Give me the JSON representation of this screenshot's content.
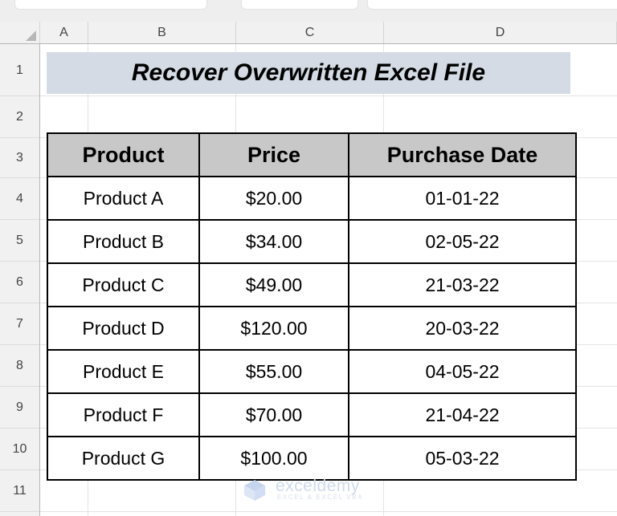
{
  "app": {
    "type": "spreadsheet",
    "ribbon_groups": [
      "ribbon-group-1",
      "ribbon-group-2",
      "ribbon-group-3"
    ]
  },
  "grid": {
    "select_all_icon": "select-all-triangle-icon",
    "column_headers": [
      "A",
      "B",
      "C",
      "D"
    ],
    "row_headers": [
      "1",
      "2",
      "3",
      "4",
      "5",
      "6",
      "7",
      "8",
      "9",
      "10",
      "11"
    ]
  },
  "title_banner": {
    "text": "Recover Overwritten Excel File",
    "background": "#d4dbe4",
    "cell_range": "B2:D2"
  },
  "table": {
    "header_background": "#c8c8c8",
    "border_color": "#000000",
    "columns": [
      "Product",
      "Price",
      "Purchase Date"
    ],
    "rows": [
      {
        "product": "Product A",
        "price": "$20.00",
        "date": "01-01-22"
      },
      {
        "product": "Product B",
        "price": "$34.00",
        "date": "02-05-22"
      },
      {
        "product": "Product C",
        "price": "$49.00",
        "date": "21-03-22"
      },
      {
        "product": "Product D",
        "price": "$120.00",
        "date": "20-03-22"
      },
      {
        "product": "Product E",
        "price": "$55.00",
        "date": "04-05-22"
      },
      {
        "product": "Product F",
        "price": "$70.00",
        "date": "21-04-22"
      },
      {
        "product": "Product G",
        "price": "$100.00",
        "date": "05-03-22"
      }
    ]
  },
  "watermark": {
    "text": "exceldemy",
    "subtext": "EXCEL & EXCEL VBA",
    "color": "#cdd9ef",
    "logo_icon": "exceldemy-cube-logo-icon"
  }
}
